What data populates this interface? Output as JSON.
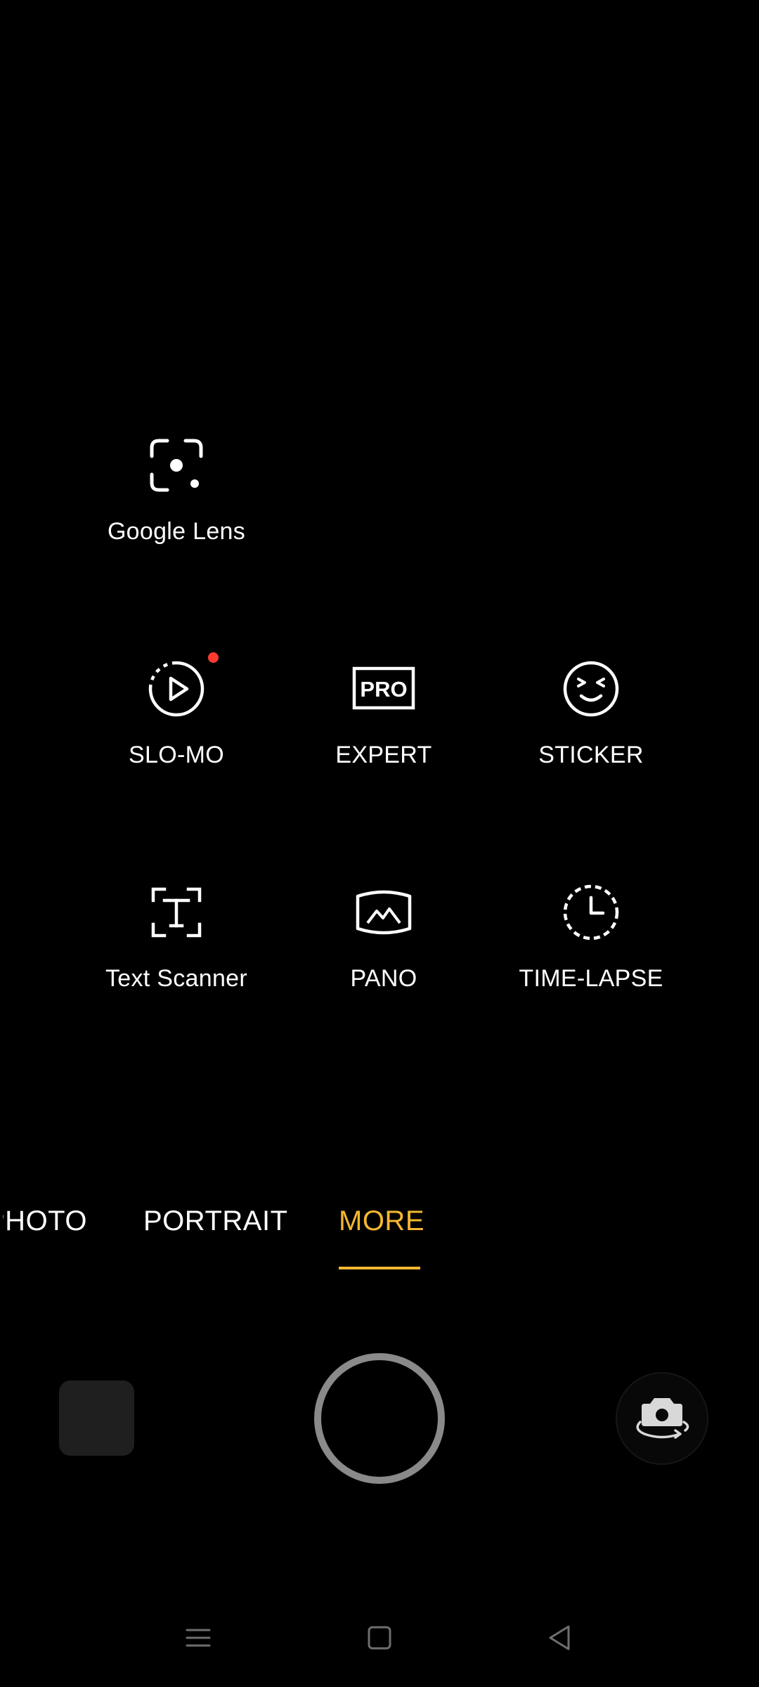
{
  "modes": {
    "google_lens": {
      "label": "Google Lens",
      "icon": "google-lens-icon"
    },
    "slo_mo": {
      "label": "SLO-MO",
      "icon": "slo-mo-icon",
      "has_badge": true
    },
    "expert": {
      "label": "EXPERT",
      "icon": "pro-icon",
      "icon_text": "PRO"
    },
    "sticker": {
      "label": "STICKER",
      "icon": "sticker-icon"
    },
    "text_scanner": {
      "label": "Text Scanner",
      "icon": "text-scanner-icon",
      "icon_text": "T"
    },
    "pano": {
      "label": "PANO",
      "icon": "pano-icon"
    },
    "time_lapse": {
      "label": "TIME-LAPSE",
      "icon": "time-lapse-icon"
    }
  },
  "mode_strip": {
    "photo": "PHOTO",
    "portrait": "PORTRAIT",
    "more": "MORE",
    "active": "more"
  },
  "controls": {
    "gallery": "gallery-thumbnail",
    "shutter": "shutter-button",
    "flip": "camera-flip-icon"
  },
  "navbar": {
    "menu": "menu-icon",
    "home": "home-icon",
    "back": "back-icon"
  },
  "colors": {
    "background": "#000000",
    "accent": "#f5b731",
    "badge": "#ff3b30",
    "shutter_ring": "#8a8a8a",
    "nav_icon": "#6e6e6e"
  }
}
